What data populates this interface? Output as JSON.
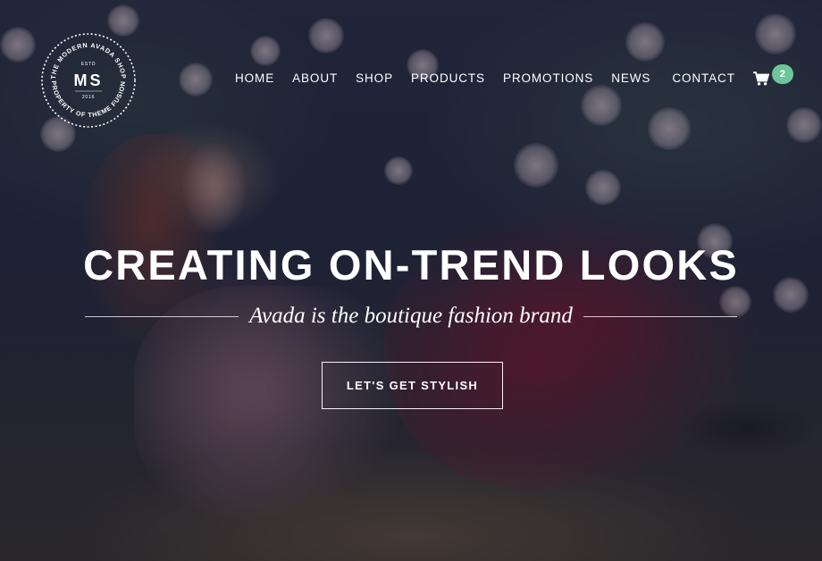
{
  "logo": {
    "monogram": "MS",
    "top_arc": "THE MODERN AVADA SHOP",
    "bottom_arc": "PROPERTY OF THEME FUSION",
    "estd": "ESTD",
    "year": "2016"
  },
  "nav": {
    "items": [
      {
        "label": "HOME"
      },
      {
        "label": "ABOUT"
      },
      {
        "label": "SHOP"
      },
      {
        "label": "PRODUCTS"
      },
      {
        "label": "PROMOTIONS"
      },
      {
        "label": "NEWS"
      },
      {
        "label": "CONTACT"
      }
    ],
    "cart_icon": "shopping-cart-icon",
    "cart_count": "2"
  },
  "hero": {
    "headline": "CREATING ON-TREND LOOKS",
    "tagline": "Avada is the boutique fashion brand",
    "cta_label": "LET'S GET STYLISH"
  },
  "colors": {
    "badge": "#6fc59a",
    "overlay": "#161830",
    "text": "#ffffff"
  }
}
